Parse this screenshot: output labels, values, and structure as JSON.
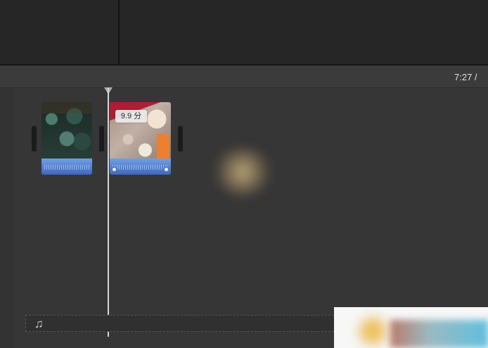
{
  "timecode": "7:27 /",
  "clips": [
    {
      "id": "clip-1",
      "badge": ""
    },
    {
      "id": "clip-2",
      "badge": "9.9 分"
    }
  ],
  "music_lane": {
    "icon": "♫"
  },
  "colors": {
    "audio_blue": "#4f7fd0",
    "playhead": "#d7d7d7",
    "background": "#363636"
  }
}
